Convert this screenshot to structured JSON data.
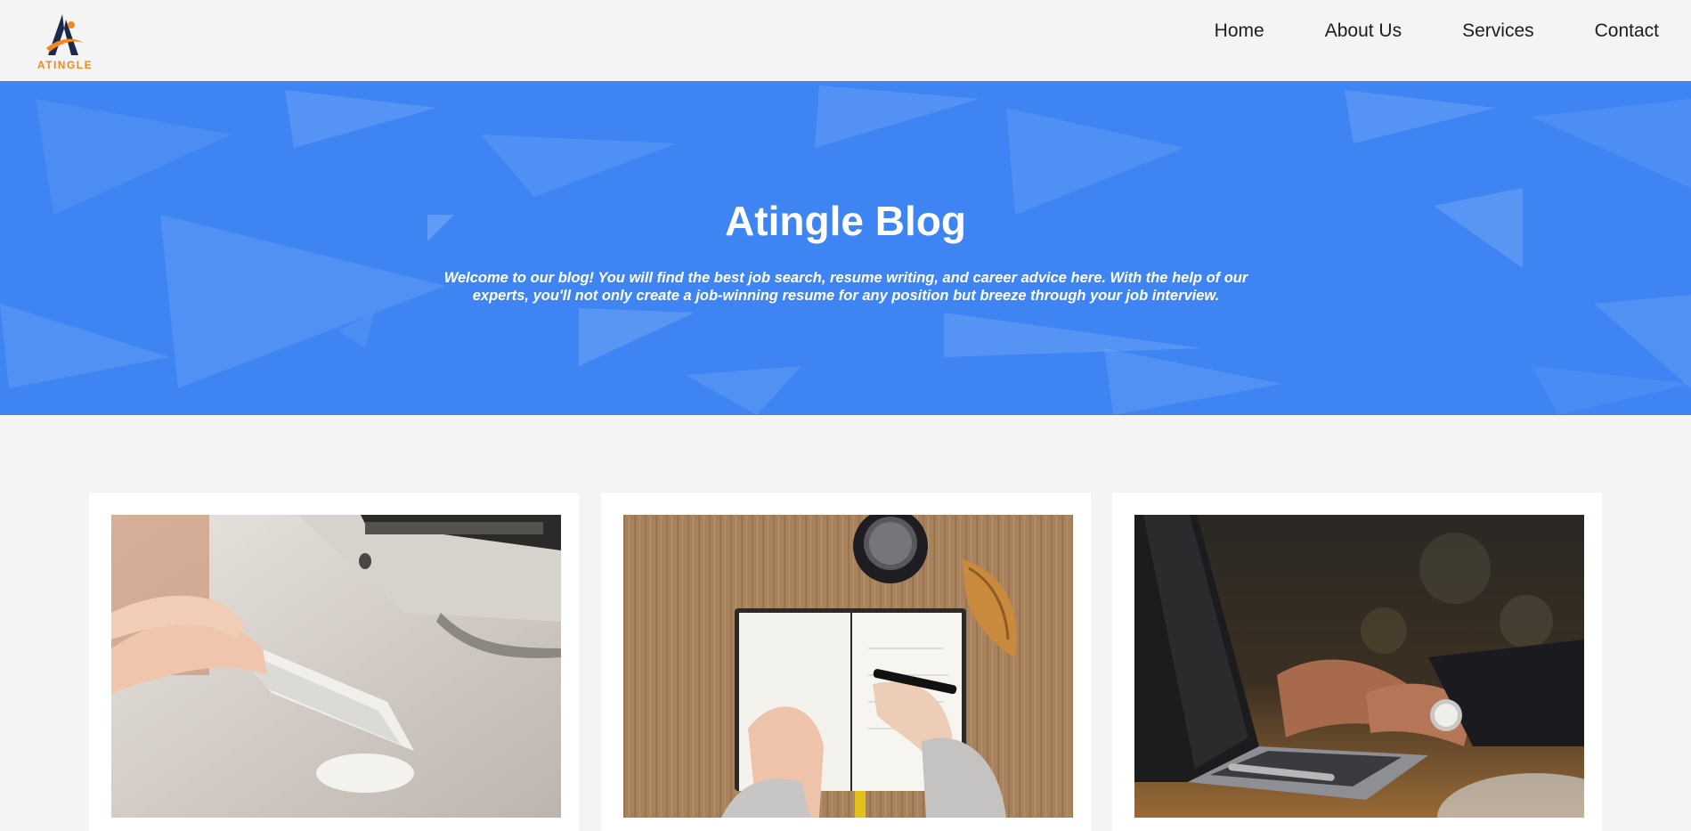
{
  "brand": {
    "logo_text": "ATINGLE",
    "logo_colors": {
      "navy": "#1b2a4a",
      "orange": "#f08a1c"
    }
  },
  "nav": {
    "items": [
      {
        "label": "Home"
      },
      {
        "label": "About Us"
      },
      {
        "label": "Services"
      },
      {
        "label": "Contact"
      }
    ]
  },
  "hero": {
    "title": "Atingle Blog",
    "subtitle": "Welcome to our blog! You will find the best job search, resume writing, and career advice here. With the help of our experts, you'll not only create a job-winning resume for any position but breeze through your job interview.",
    "background_color": "#3e85f3"
  },
  "posts": [
    {
      "image": "hands-typing-keyboard-photo"
    },
    {
      "image": "writing-notebook-coffee-photo"
    },
    {
      "image": "hands-typing-laptop-photo"
    }
  ]
}
